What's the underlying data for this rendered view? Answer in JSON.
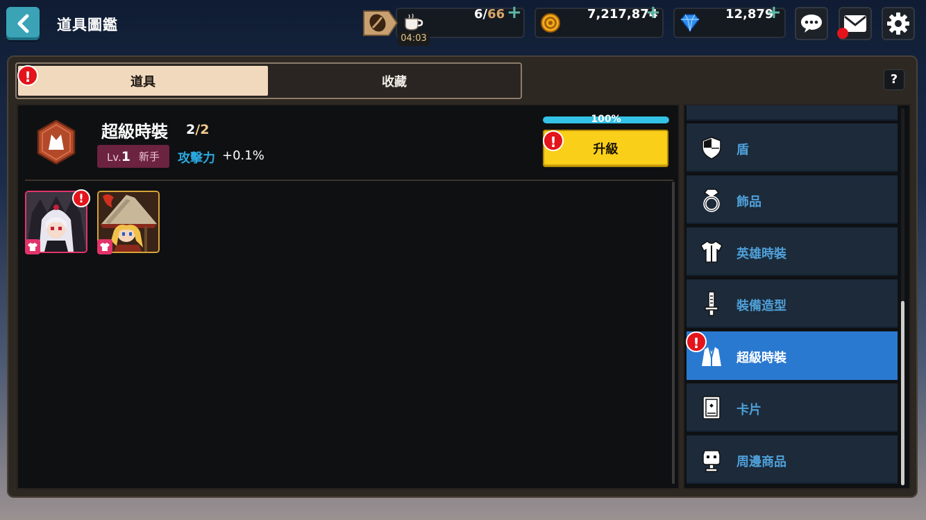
{
  "header": {
    "title": "道具圖鑑",
    "stamina": {
      "current": "6",
      "separator": "/",
      "max": "66",
      "timer": "04:03"
    },
    "gold": "7,217,874",
    "gems": "12,879"
  },
  "tabs": [
    {
      "label": "道具",
      "active": true
    },
    {
      "label": "收藏",
      "active": false
    }
  ],
  "help_label": "?",
  "item": {
    "title": "超級時裝",
    "count_current": "2",
    "count_sep": "/",
    "count_max": "2",
    "level_prefix": "Lv.",
    "level_value": "1",
    "rank": "新手",
    "stat_label": "攻擊力",
    "stat_value": "+0.1%",
    "progress_text": "100%",
    "progress": 1.0,
    "upgrade_label": "升級"
  },
  "collection": [
    {
      "name": "dark-hero-costume",
      "has_alert": true
    },
    {
      "name": "witch-hero-costume",
      "has_alert": false
    }
  ],
  "categories": [
    {
      "label": "盾",
      "icon": "shield-icon",
      "active": false,
      "alert": false
    },
    {
      "label": "飾品",
      "icon": "ring-icon",
      "active": false,
      "alert": false
    },
    {
      "label": "英雄時裝",
      "icon": "shirt-icon",
      "active": false,
      "alert": false
    },
    {
      "label": "裝備造型",
      "icon": "sword-icon",
      "active": false,
      "alert": false
    },
    {
      "label": "超級時裝",
      "icon": "suit-icon",
      "active": true,
      "alert": true
    },
    {
      "label": "卡片",
      "icon": "card-icon",
      "active": false,
      "alert": false
    },
    {
      "label": "周邊商品",
      "icon": "figure-icon",
      "active": false,
      "alert": false
    }
  ],
  "alert_glyph": "!",
  "colors": {
    "accent_blue": "#2a79d0",
    "upgrade_yellow": "#f9cf1a",
    "alert_red": "#e3141b",
    "progress": "#34c2e6"
  }
}
